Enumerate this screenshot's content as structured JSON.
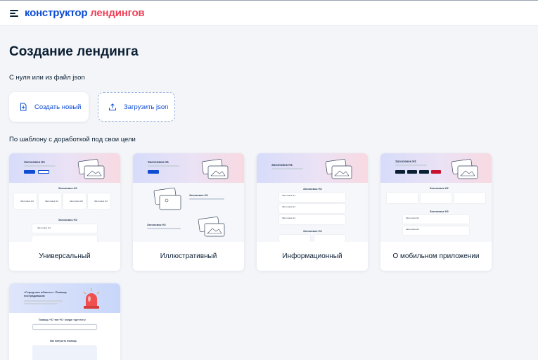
{
  "header": {
    "logo_part1": "конструктор",
    "logo_part2": "лендингов"
  },
  "page": {
    "title": "Создание лендинга",
    "section_blank_label": "С нуля или из файл json",
    "section_template_label": "По шаблону с доработкой под свои цели"
  },
  "actions": {
    "create_new": "Создать новый",
    "upload_json": "Загрузить json"
  },
  "templates": [
    {
      "label": "Универсальный"
    },
    {
      "label": "Иллюстративный"
    },
    {
      "label": "Информационный"
    },
    {
      "label": "О мобильном приложении"
    },
    {
      "label": ""
    }
  ],
  "thumb_text": {
    "h1": "Заголовок H1",
    "h2": "Заголовок H2",
    "h4": "Заголовок H4",
    "promo_title": "«Город или область»: Помощь пострадавшим",
    "promo_sub": "Помощь ЧС ‹тип ЧС› ‹когда› ‹где›‹есть›",
    "promo_h2": "Как получить помощь"
  },
  "colors": {
    "primary": "#0d4cd3",
    "accent": "#ee3f58",
    "text": "#0b1f33",
    "background": "#f3f5f9"
  }
}
